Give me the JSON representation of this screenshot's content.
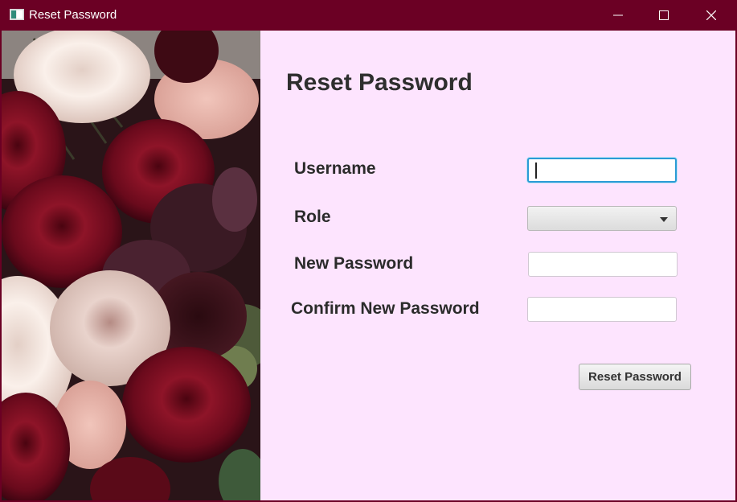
{
  "window": {
    "title": "Reset Password",
    "titlebar_color": "#6b0024",
    "icons": [
      "app-window-icon",
      "minimize-icon",
      "maximize-icon",
      "close-icon"
    ]
  },
  "form": {
    "heading": "Reset Password",
    "background_color": "#fde4fe",
    "username_label": "Username",
    "username_value": "",
    "role_label": "Role",
    "role_selected": "",
    "new_password_label": "New Password",
    "new_password_value": "",
    "confirm_password_label": "Confirm New Password",
    "confirm_password_value": "",
    "submit_label": "Reset Password",
    "focus_color": "#2b9bd6"
  },
  "photo": {
    "subject": "roses-bouquet-image"
  }
}
